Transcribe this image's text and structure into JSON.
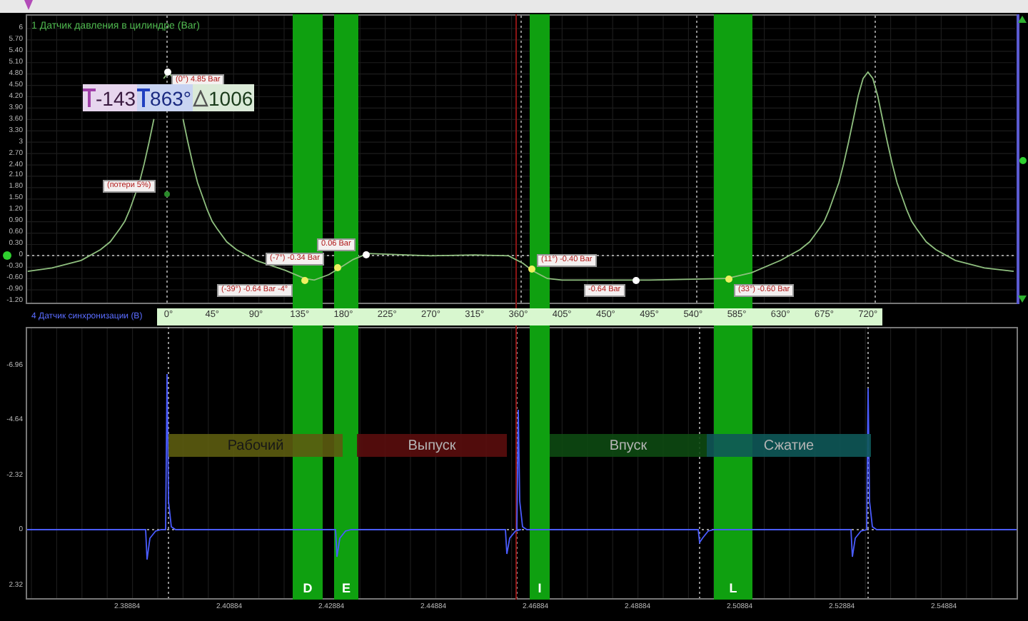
{
  "panels": [
    {
      "title": "1 Датчик давления в цилиндре (Bar)",
      "chart_data": {
        "type": "line",
        "xlim": [
          -147,
          873
        ],
        "ylim": [
          -1.275,
          6.377
        ],
        "xticks": [
          {
            "value": 0,
            "label": "0°"
          },
          {
            "value": 45,
            "label": "45°"
          },
          {
            "value": 90,
            "label": "90°"
          },
          {
            "value": 135,
            "label": "135°"
          },
          {
            "value": 180,
            "label": "180°"
          },
          {
            "value": 225,
            "label": "225°"
          },
          {
            "value": 270,
            "label": "270°"
          },
          {
            "value": 315,
            "label": "315°"
          },
          {
            "value": 360,
            "label": "360°"
          },
          {
            "value": 405,
            "label": "405°"
          },
          {
            "value": 450,
            "label": "450°"
          },
          {
            "value": 495,
            "label": "495°"
          },
          {
            "value": 540,
            "label": "540°"
          },
          {
            "value": 585,
            "label": "585°"
          },
          {
            "value": 630,
            "label": "630°"
          },
          {
            "value": 675,
            "label": "675°"
          },
          {
            "value": 720,
            "label": "720°"
          }
        ],
        "yticks": [
          {
            "value": 6,
            "label": "6"
          },
          {
            "value": 5.7,
            "label": "5.70"
          },
          {
            "value": 5.4,
            "label": "5.40"
          },
          {
            "value": 5.1,
            "label": "5.10"
          },
          {
            "value": 4.8,
            "label": "4.80"
          },
          {
            "value": 4.5,
            "label": "4.50"
          },
          {
            "value": 4.2,
            "label": "4.20"
          },
          {
            "value": 3.9,
            "label": "3.90"
          },
          {
            "value": 3.6,
            "label": "3.60"
          },
          {
            "value": 3.3,
            "label": "3.30"
          },
          {
            "value": 3,
            "label": "3"
          },
          {
            "value": 2.7,
            "label": "2.70"
          },
          {
            "value": 2.4,
            "label": "2.40"
          },
          {
            "value": 2.1,
            "label": "2.10"
          },
          {
            "value": 1.8,
            "label": "1.80"
          },
          {
            "value": 1.5,
            "label": "1.50"
          },
          {
            "value": 1.2,
            "label": "1.20"
          },
          {
            "value": 0.9,
            "label": "0.90"
          },
          {
            "value": 0.6,
            "label": "0.60"
          },
          {
            "value": 0.3,
            "label": "0.30"
          },
          {
            "value": 0,
            "label": "0"
          },
          {
            "value": -0.3,
            "label": "-0.30"
          },
          {
            "value": -0.6,
            "label": "-0.60"
          },
          {
            "value": -0.9,
            "label": "-0.90"
          },
          {
            "value": -1.2,
            "label": "-1.20"
          }
        ],
        "x": [
          -145,
          -120,
          -90,
          -70,
          -60,
          -50,
          -45,
          -40,
          -30,
          -25,
          -20,
          -15,
          -10,
          -5,
          0,
          5,
          10,
          15,
          20,
          25,
          30,
          40,
          45,
          50,
          60,
          70,
          90,
          120,
          140,
          150,
          165,
          175,
          190,
          205,
          225,
          270,
          315,
          350,
          365,
          375,
          390,
          405,
          450,
          495,
          540,
          575,
          600,
          630,
          650,
          660,
          670,
          675,
          680,
          690,
          695,
          700,
          705,
          710,
          715,
          720,
          725,
          730,
          735,
          740,
          745,
          750,
          760,
          765,
          770,
          780,
          790,
          810,
          840,
          870
        ],
        "series": [
          {
            "color": "#8fbf7f",
            "values": [
              -0.41,
              -0.32,
              -0.12,
              0.16,
              0.37,
              0.72,
              0.91,
              1.21,
              1.93,
              2.43,
              3.0,
              3.61,
              null,
              4.68,
              4.85,
              4.68,
              null,
              3.61,
              3.0,
              2.43,
              1.93,
              1.21,
              0.91,
              0.72,
              0.37,
              0.16,
              -0.12,
              -0.38,
              -0.6,
              -0.64,
              -0.5,
              -0.34,
              -0.1,
              0.06,
              0.04,
              0.0,
              0.02,
              0.0,
              -0.2,
              -0.4,
              -0.6,
              -0.64,
              -0.64,
              -0.64,
              -0.62,
              -0.6,
              -0.45,
              -0.12,
              0.16,
              0.37,
              0.72,
              0.91,
              1.21,
              1.93,
              2.43,
              3.0,
              3.61,
              4.23,
              4.68,
              4.85,
              4.68,
              4.23,
              3.61,
              3.0,
              2.43,
              1.93,
              1.21,
              0.91,
              0.72,
              0.37,
              0.16,
              -0.12,
              -0.32,
              -0.41
            ]
          }
        ]
      }
    },
    {
      "title": "4 Датчик синхронизации (В)",
      "y_labels": [
        "-6.96",
        "-4.64",
        "-2.32",
        "0",
        "2.32"
      ]
    }
  ],
  "measurement": {
    "marker_a": "-143",
    "marker_b": "863°",
    "delta": "1006"
  },
  "annotations": [
    "(0°) 4.85 Bar",
    "(потери 5%)",
    "0.06 Bar",
    "(-7°) -0.34 Bar",
    "(-39°) -0.64 Bar -4°",
    "(11°) -0.40 Bar",
    "-0.64 Bar",
    "(33°) -0.60 Bar"
  ],
  "time_axis": [
    "2.38884",
    "2.40884",
    "2.42884",
    "2.44884",
    "2.46884",
    "2.48884",
    "2.50884",
    "2.52884",
    "2.54884"
  ],
  "zones": [
    {
      "label": "D"
    },
    {
      "label": "E"
    },
    {
      "label": "I"
    },
    {
      "label": "L"
    }
  ],
  "phases": [
    {
      "label": "Рабочий",
      "color": "#5c5c10"
    },
    {
      "label": "Выпуск",
      "color": "#5a0e0e"
    },
    {
      "label": "Впуск",
      "color": "#0e4a12"
    },
    {
      "label": "Сжатие",
      "color": "#0f5858"
    }
  ]
}
